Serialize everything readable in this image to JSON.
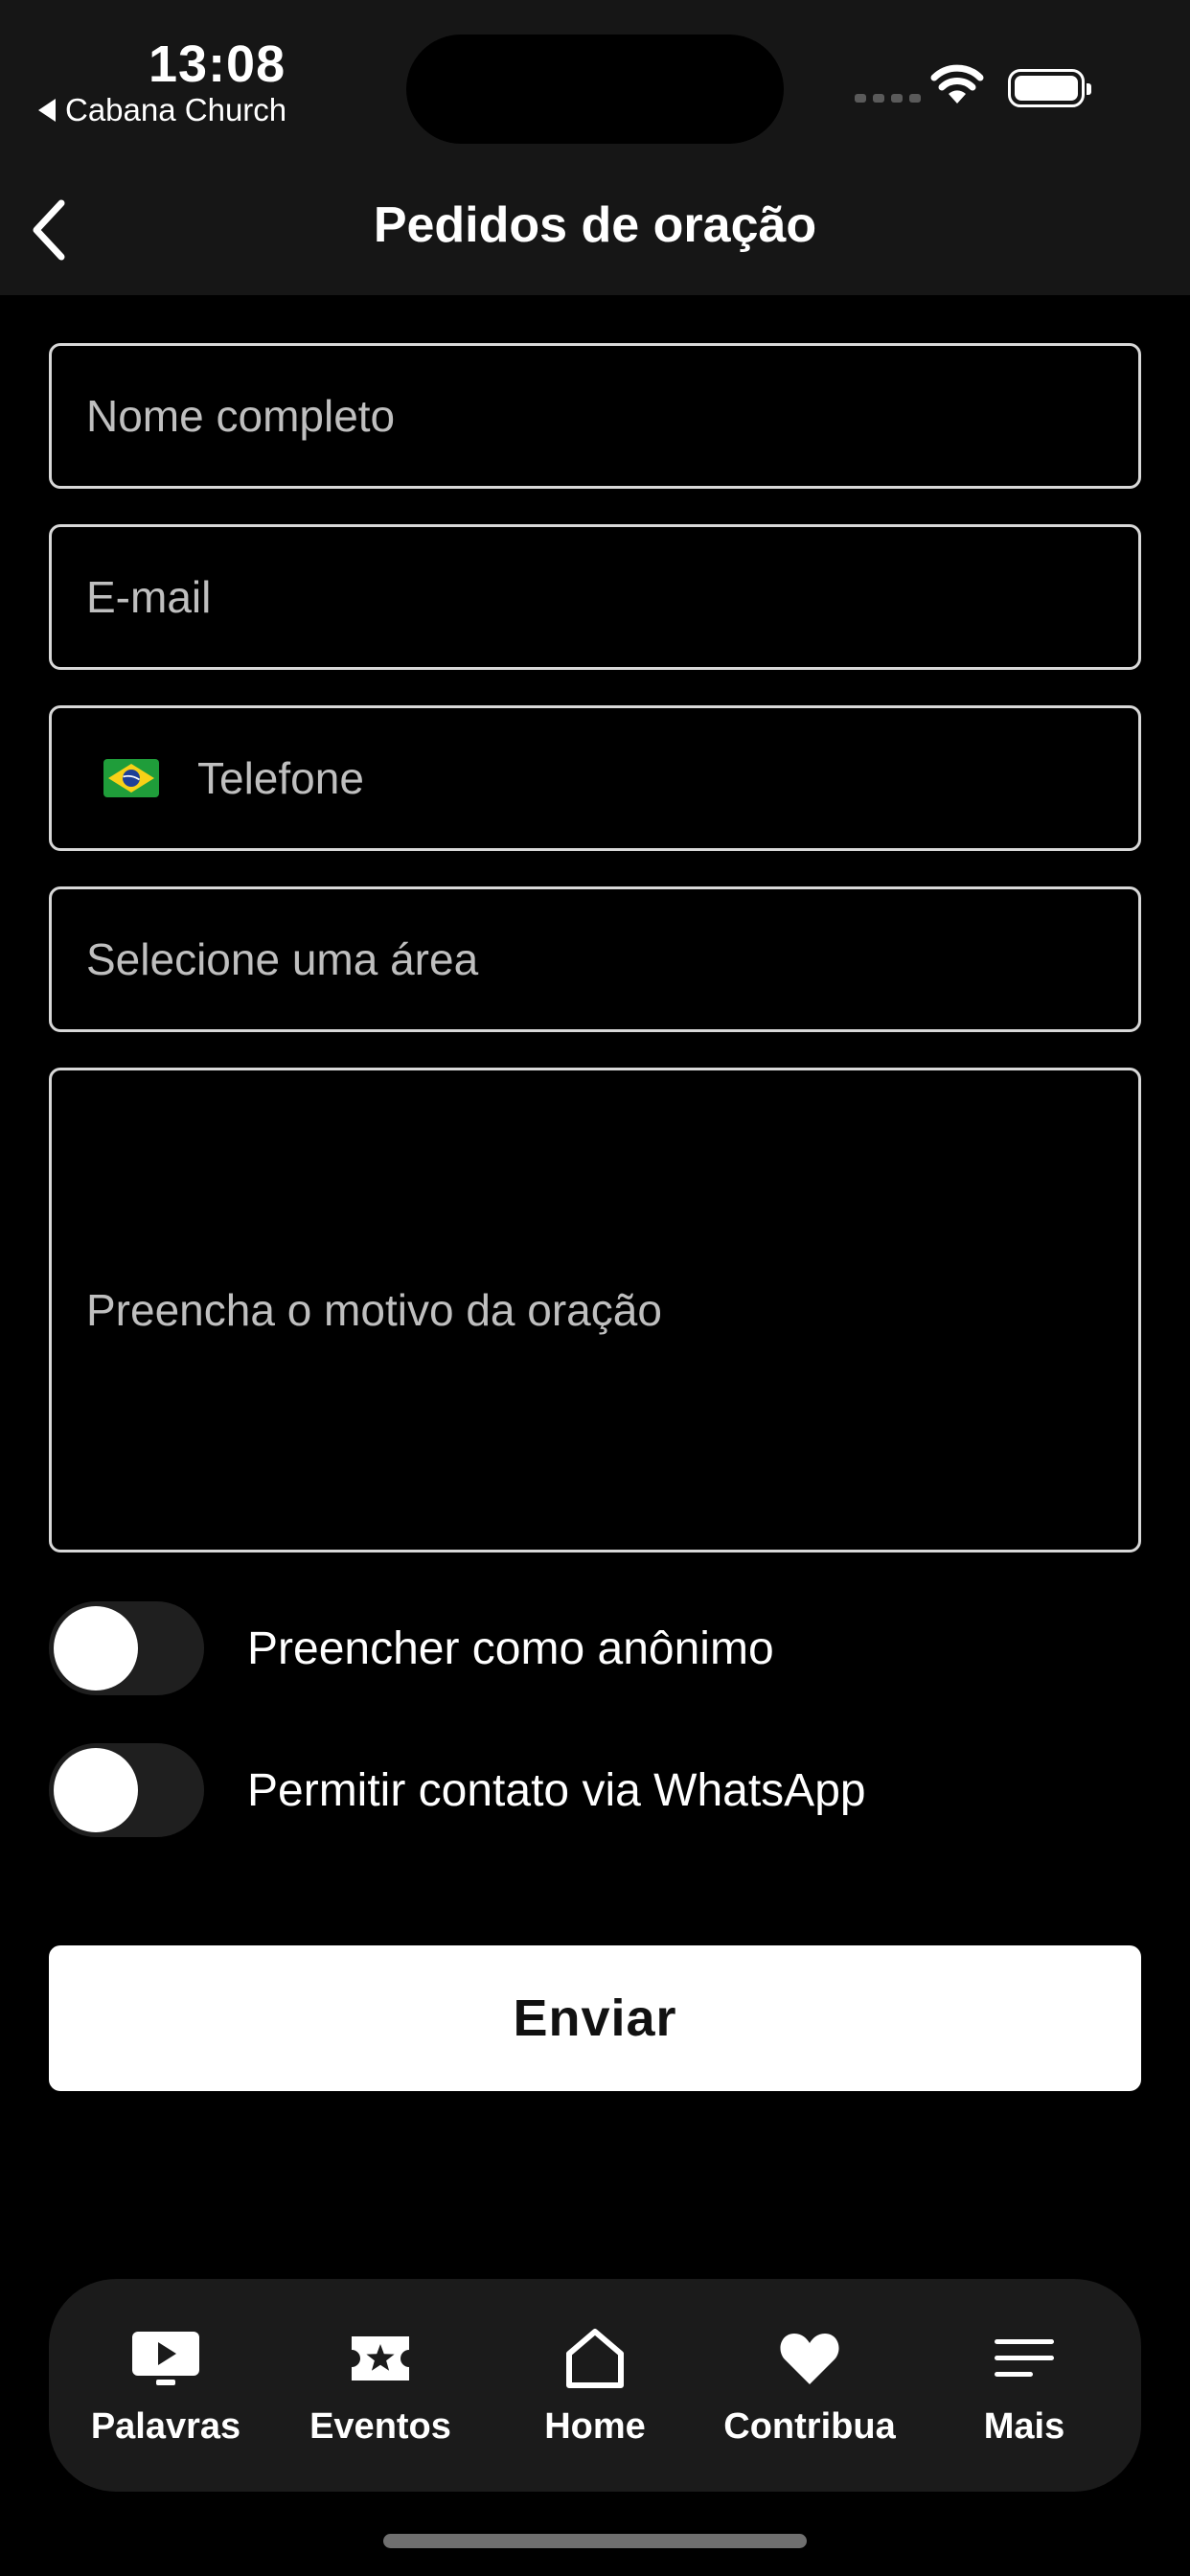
{
  "status_bar": {
    "time": "13:08",
    "back_app_label": "Cabana Church"
  },
  "nav": {
    "title": "Pedidos de oração"
  },
  "form": {
    "name_placeholder": "Nome completo",
    "email_placeholder": "E-mail",
    "phone_placeholder": "Telefone",
    "phone_country_flag": "brazil-flag-icon",
    "area_placeholder": "Selecione uma área",
    "reason_placeholder": "Preencha o motivo da oração",
    "toggles": [
      {
        "label": "Preencher como anônimo",
        "on": false
      },
      {
        "label": "Permitir contato via WhatsApp",
        "on": false
      }
    ],
    "submit_label": "Enviar"
  },
  "tabbar": {
    "items": [
      {
        "label": "Palavras",
        "icon": "play-screen-icon"
      },
      {
        "label": "Eventos",
        "icon": "ticket-star-icon"
      },
      {
        "label": "Home",
        "icon": "house-icon"
      },
      {
        "label": "Contribua",
        "icon": "heart-icon"
      },
      {
        "label": "Mais",
        "icon": "menu-lines-icon"
      }
    ]
  },
  "colors": {
    "background": "#000000",
    "header": "#161616",
    "field_border": "#d8d8d8",
    "tabbar": "#1b1b1b",
    "button": "#ffffff"
  }
}
